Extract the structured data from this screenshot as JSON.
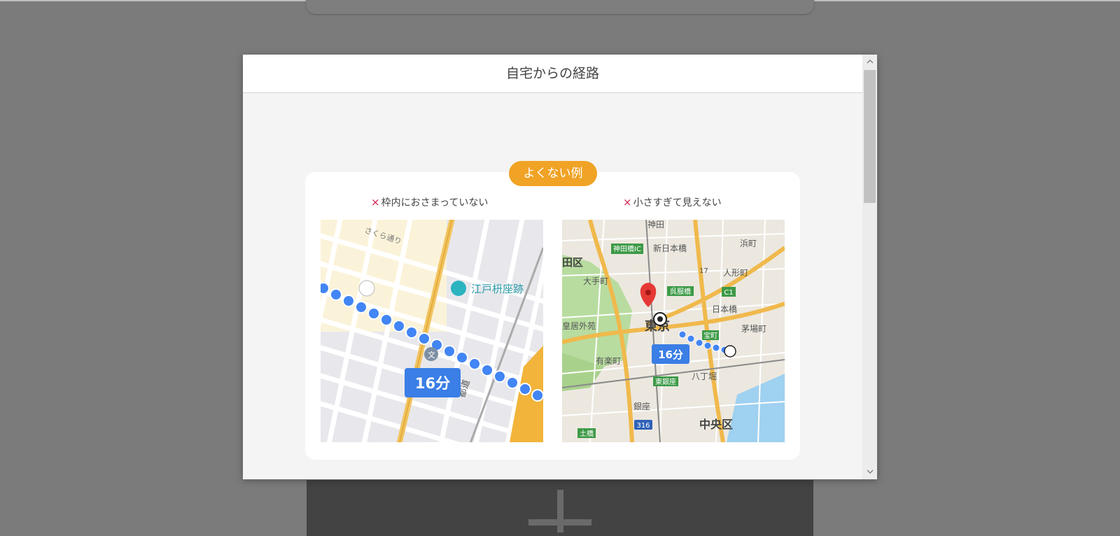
{
  "modal": {
    "title": "自宅からの経路",
    "badge": "よくない例",
    "examples": [
      {
        "mark": "×",
        "caption": "枠内におさまっていない",
        "map": {
          "time_label": "16分",
          "labels": [
            "江戸枡座跡",
            "さくら通り",
            "都道",
            "文"
          ]
        }
      },
      {
        "mark": "×",
        "caption": "小さすぎて見えない",
        "map": {
          "time_label": "16分",
          "labels": [
            "神田",
            "神田橋IC",
            "新日本橋",
            "浜町",
            "田区",
            "大手町",
            "人形町",
            "呉服橋",
            "C1",
            "日本橋",
            "茅場町",
            "東京",
            "皇居外苑",
            "宝町",
            "有楽町",
            "八丁堀",
            "東銀座",
            "銀座",
            "中央区",
            "316",
            "土橋",
            "17"
          ]
        }
      }
    ]
  },
  "colors": {
    "badge": "#f0a325",
    "mark": "#d0234e",
    "route": "#4285f4",
    "pin": "#e53935"
  },
  "icons": [
    "close-mark-icon",
    "scroll-up-icon",
    "scroll-down-icon",
    "plus-icon",
    "map-pin-icon",
    "location-icon"
  ]
}
